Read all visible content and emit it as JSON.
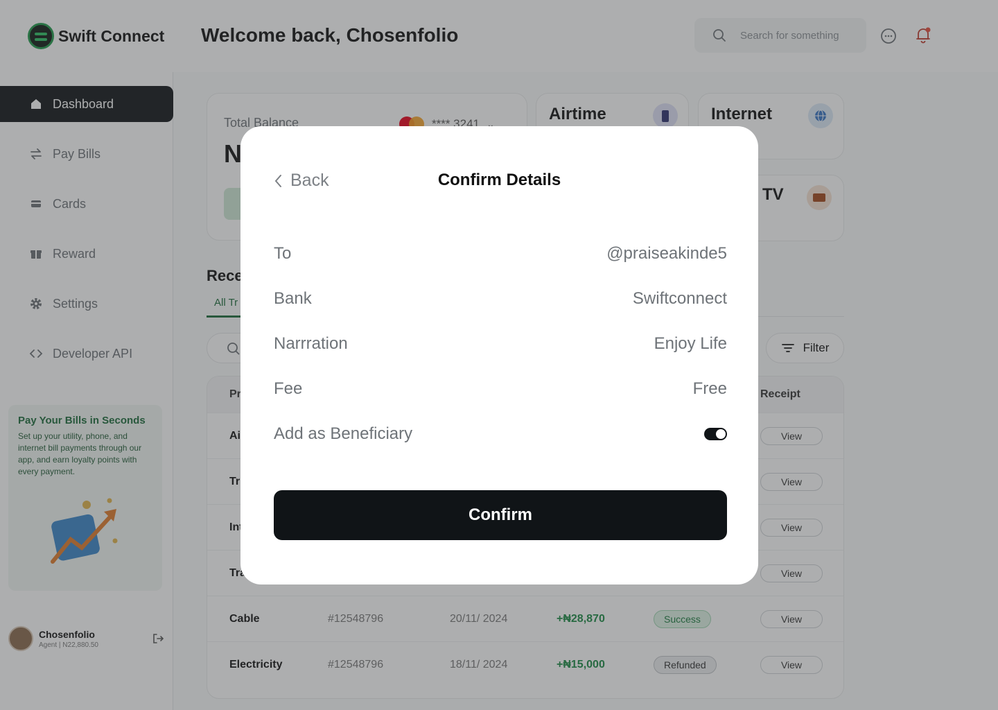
{
  "app": {
    "name": "Swift Connect"
  },
  "header": {
    "welcome": "Welcome back, Chosenfolio",
    "search_placeholder": "Search for something"
  },
  "sidebar": {
    "items": [
      {
        "label": "Dashboard",
        "icon": "home-icon"
      },
      {
        "label": "Pay Bills",
        "icon": "transfer-icon"
      },
      {
        "label": "Cards",
        "icon": "card-icon"
      },
      {
        "label": "Reward",
        "icon": "gift-icon"
      },
      {
        "label": "Settings",
        "icon": "gear-icon"
      },
      {
        "label": "Developer API",
        "icon": "code-icon"
      }
    ],
    "promo": {
      "title": "Pay Your Bills in Seconds",
      "text": "Set up your utility, phone, and internet bill payments through our app, and earn loyalty points with every payment."
    },
    "profile": {
      "name": "Chosenfolio",
      "role": "Agent | N22,880.50"
    }
  },
  "dashboard": {
    "balance_label": "Total Balance",
    "balance_partial": "N",
    "card_mask": "**** 3241",
    "quick": {
      "airtime": "Airtime",
      "internet": "Internet",
      "tv": "TV"
    },
    "recent_title": "Rece",
    "tab_all": "All Tr",
    "filter_label": "Filter",
    "table": {
      "col_first": "Pr",
      "col_receipt": "Receipt",
      "partial_rows": [
        "Ai",
        "Tr",
        "Int",
        "Tra"
      ],
      "rows": [
        {
          "product": "Cable",
          "id": "#12548796",
          "date": "20/11/ 2024",
          "amount": "+₦28,870",
          "status": "Success"
        },
        {
          "product": "Electricity",
          "id": "#12548796",
          "date": "18/11/ 2024",
          "amount": "+₦15,000",
          "status": "Refunded"
        }
      ],
      "view_label": "View"
    }
  },
  "modal": {
    "back": "Back",
    "title": "Confirm Details",
    "rows": [
      {
        "label": "To",
        "value": "@praiseakinde5"
      },
      {
        "label": "Bank",
        "value": "Swiftconnect"
      },
      {
        "label": "Narrration",
        "value": "Enjoy Life"
      },
      {
        "label": "Fee",
        "value": "Free"
      }
    ],
    "beneficiary_label": "Add as Beneficiary",
    "beneficiary_on": true,
    "confirm": "Confirm"
  }
}
